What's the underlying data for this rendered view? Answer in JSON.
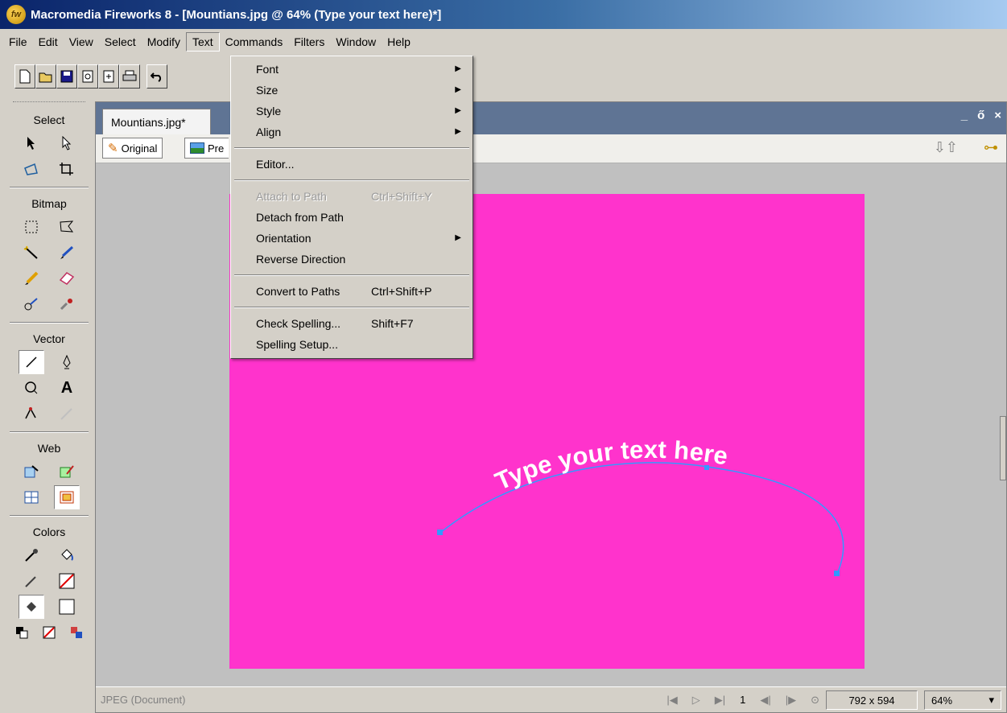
{
  "window": {
    "title": "Macromedia Fireworks 8 - [Mountians.jpg @ 64% (Type your text here)*]",
    "logo_text": "fw"
  },
  "menubar": {
    "items": [
      "File",
      "Edit",
      "View",
      "Select",
      "Modify",
      "Text",
      "Commands",
      "Filters",
      "Window",
      "Help"
    ],
    "active": "Text"
  },
  "toolbar": {
    "icons": [
      "new-file-icon",
      "open-folder-icon",
      "save-disk-icon",
      "import-icon",
      "export-icon",
      "print-icon",
      "undo-icon"
    ]
  },
  "tools": {
    "headings": {
      "select": "Select",
      "bitmap": "Bitmap",
      "vector": "Vector",
      "web": "Web",
      "colors": "Colors"
    },
    "text_tool_label": "A"
  },
  "document": {
    "tab_label": "Mountians.jpg*",
    "controls": {
      "minimize": "_",
      "restore": "ő",
      "close": "×"
    },
    "view_buttons": {
      "original": "Original",
      "preview": "Pre"
    },
    "canvas_color": "#ff33cc",
    "path_text": "Type your text here"
  },
  "statusbar": {
    "doc_type": "JPEG (Document)",
    "frame": "1",
    "dimensions": "792 x 594",
    "zoom": "64%"
  },
  "text_menu": {
    "font": "Font",
    "size": "Size",
    "style": "Style",
    "align": "Align",
    "editor": "Editor...",
    "attach": "Attach to Path",
    "attach_shortcut": "Ctrl+Shift+Y",
    "detach": "Detach from Path",
    "orientation": "Orientation",
    "reverse": "Reverse Direction",
    "convert": "Convert to Paths",
    "convert_shortcut": "Ctrl+Shift+P",
    "check": "Check Spelling...",
    "check_shortcut": "Shift+F7",
    "setup": "Spelling Setup..."
  }
}
